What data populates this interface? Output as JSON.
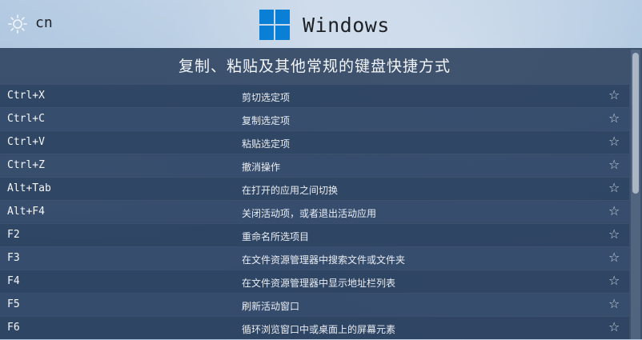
{
  "header": {
    "theme_icon": "sun-icon",
    "lang": "cn",
    "brand_icon": "windows-logo-icon",
    "title": "Windows",
    "brand_color": "#0a7fd6"
  },
  "section": {
    "title": "复制、粘贴及其他常规的键盘快捷方式"
  },
  "star_icon": "star-outline-icon",
  "star_glyph": "☆",
  "shortcuts": [
    {
      "key": "Ctrl+X",
      "desc": "剪切选定项"
    },
    {
      "key": "Ctrl+C",
      "desc": "复制选定项"
    },
    {
      "key": "Ctrl+V",
      "desc": "粘贴选定项"
    },
    {
      "key": "Ctrl+Z",
      "desc": "撤消操作"
    },
    {
      "key": "Alt+Tab",
      "desc": "在打开的应用之间切换"
    },
    {
      "key": "Alt+F4",
      "desc": "关闭活动项，或者退出活动应用"
    },
    {
      "key": "F2",
      "desc": "重命名所选项目"
    },
    {
      "key": "F3",
      "desc": "在文件资源管理器中搜索文件或文件夹"
    },
    {
      "key": "F4",
      "desc": "在文件资源管理器中显示地址栏列表"
    },
    {
      "key": "F5",
      "desc": "刷新活动窗口"
    },
    {
      "key": "F6",
      "desc": "循环浏览窗口中或桌面上的屏幕元素"
    }
  ]
}
